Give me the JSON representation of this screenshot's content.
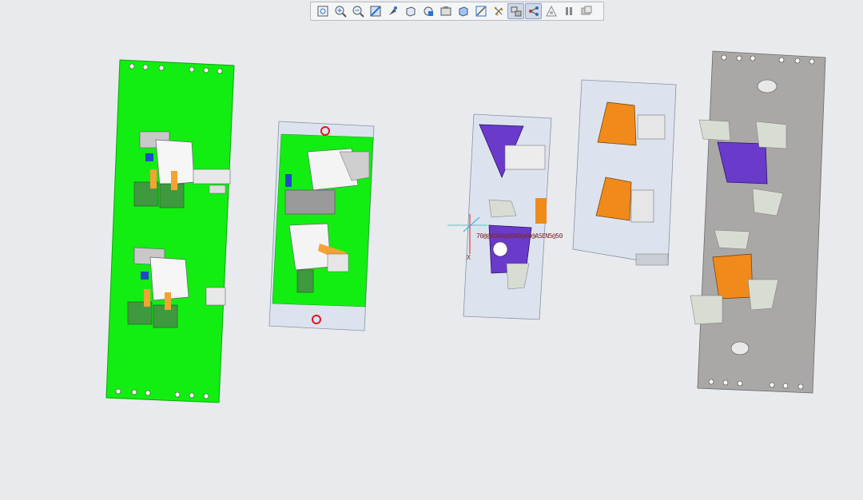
{
  "toolbar": {
    "buttons": [
      {
        "name": "refit-icon"
      },
      {
        "name": "zoom-in-icon"
      },
      {
        "name": "zoom-out-icon"
      },
      {
        "name": "repaint-icon"
      },
      {
        "name": "reorient-icon"
      },
      {
        "name": "saved-orientations-icon"
      },
      {
        "name": "view-manager-icon"
      },
      {
        "name": "display-style-icon"
      },
      {
        "name": "datum-display-icon"
      },
      {
        "name": "annotation-display-icon"
      },
      {
        "name": "spin-center-icon"
      },
      {
        "name": "exploded-view-icon",
        "active": true
      },
      {
        "name": "connection-view-icon",
        "active": true
      },
      {
        "name": "simplified-rep-icon"
      },
      {
        "name": "pause-icon"
      },
      {
        "name": "appearance-icon"
      }
    ]
  },
  "viewport": {
    "csys_axis_label": "X",
    "dimension_text": "70@@A0A0@A0A0@A0@ASEN5@50"
  },
  "colors": {
    "background": "#e8eaee",
    "green_plate": "#12ee12",
    "light_plate": "#dde3ee",
    "gray_plate": "#a9a8a6",
    "purple_part": "#6a3acb",
    "orange_part": "#f08a1a"
  }
}
